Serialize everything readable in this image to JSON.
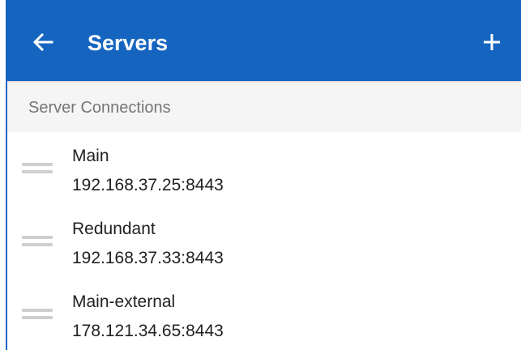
{
  "app_bar": {
    "title": "Servers",
    "back_icon": "arrow-left-icon",
    "add_icon": "plus-icon",
    "background_color": "#1565c0"
  },
  "section": {
    "header": "Server Connections"
  },
  "servers": [
    {
      "name": "Main",
      "address": "192.168.37.25:8443"
    },
    {
      "name": "Redundant",
      "address": "192.168.37.33:8443"
    },
    {
      "name": "Main-external",
      "address": "178.121.34.65:8443"
    }
  ],
  "colors": {
    "accent": "#1565c0",
    "section_background": "#f5f5f5",
    "primary_text": "#212121",
    "secondary_text": "#757575",
    "handle": "#cfcfcf"
  }
}
